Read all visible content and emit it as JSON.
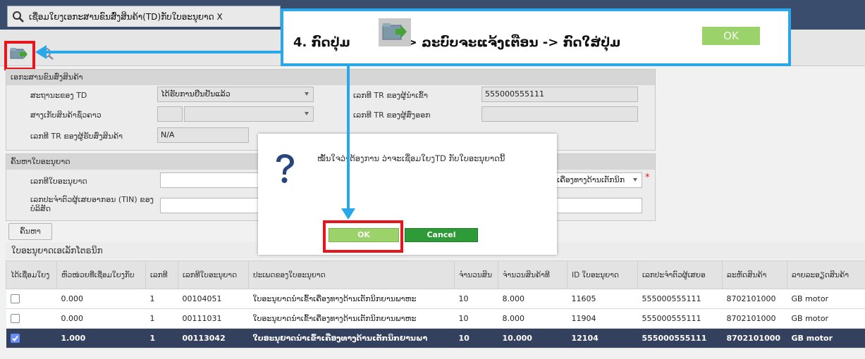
{
  "tab": {
    "title": "ເຊື່ອມໃຍງເອກະສານຂົນສົ່ງສິນຄ້າ(TD)ກັບໃບອະນຸຍາດ X"
  },
  "instruction": {
    "step": "4.",
    "part1": "ກົດປຸ່ມ",
    "part2": "-> ລະບົບຈະແຈ້ງເຕືອນ -> ກົດໃສ່ປຸ່ມ",
    "ok_label": "OK"
  },
  "panel1": {
    "header": "ເອກະສານຂົນສົ່ງສິນຄ້າ",
    "td_status_label": "ສະຖານະຂອງ TD",
    "td_status_value": "ໄດ້ຮັບການຢືນຢັນແລ້ວ",
    "carrier_tr_label": "ເລກທີ TR ຂອງຜູ້ນໍາເຂົ້າ",
    "carrier_tr_value": "555000555111",
    "transit_label": "ສາງເກັບສິນຄ້າຊົ່ວຄາວ",
    "transit_value": "",
    "sender_tr_label": "ເລກທີ TR ຂອງຜູ້ສົ່ງອອກ",
    "sender_tr_value": "",
    "receiver_tr_label": "ເລກທີ TR ຂອງຜູ້ຮັບສົ່ງສິນຄ້າ",
    "receiver_tr_value": "N/A"
  },
  "panel2": {
    "header": "ຄົ້ນຫາໃບອະນຸຍາດ",
    "license_no_label": "ເລກທີໃບອະນຸຍາດ",
    "license_no_value": "",
    "license_type_value": "ເຄື່ອງທາງດ້ານເຕັກນິກ",
    "tin_label": "ເລກປະຈໍາຕົວຜູ້ເສຍອາກອນ (TIN) ຂອງບໍລິສັດ",
    "tin_value": "",
    "search_label": "ຄົ້ນຫາ"
  },
  "table": {
    "title": "ໃບອະນຸຍາດເອເລັກໂຕຣນິກ",
    "headers": [
      "ໄດ້ເຊື່ອມໃຍງ",
      "ຫົວໜ່ວຍທີ່ເຊື່ອມໃຍງກັບ",
      "ເລກທີ",
      "ເລກທີໃບອະນຸຍາດ",
      "ປະເພດຂອງໃບອະນຸຍາດ",
      "ຈໍານວນສິນ",
      "ຈໍານວນສິນຄ້າທີ",
      "ID ໃບອະນຸຍາດ",
      "ເລກປະຈໍາຕົວຜູ້ເສຍອ",
      "ລະຫັດສິນຄ້າ",
      "ລາຍລະອຽດສິນຄ້າ"
    ],
    "rows": [
      {
        "linked": false,
        "unit": "0.000",
        "no": "1",
        "license": "00104051",
        "type": "ໃບອະນຸຍາດນໍາເຂົ້າເຄື່ອງທາງດ້ານເຕັກນິກຍານພາຫະ",
        "qty": "10",
        "qty2": "8.000",
        "id": "11605",
        "tin": "555000555111",
        "hs": "8702101000",
        "desc": "GB motor"
      },
      {
        "linked": false,
        "unit": "0.000",
        "no": "1",
        "license": "00111031",
        "type": "ໃບອະນຸຍາດນໍາເຂົ້າເຄື່ອງທາງດ້ານເຕັກນິກຍານພາຫະ",
        "qty": "10",
        "qty2": "8.000",
        "id": "11904",
        "tin": "555000555111",
        "hs": "8702101000",
        "desc": "GB motor"
      },
      {
        "linked": true,
        "unit": "1.000",
        "no": "1",
        "license": "00113042",
        "type": "ໃບອະນຸຍາດນໍາເຂົ້າເຄື່ອງທາງດ້ານເຕັກນິກຍານພາ",
        "qty": "10",
        "qty2": "10.000",
        "id": "12104",
        "tin": "555000555111",
        "hs": "8702101000",
        "desc": "GB motor"
      }
    ]
  },
  "dialog": {
    "message": "ໝັ້ນໃຈວ່າຕ້ອງການ ວ່າຈະເຊື່ອມໃຍງTD ກັບໃບອະນຸຍາດນີ້",
    "ok_label": "OK",
    "cancel_label": "Cancel"
  },
  "colors": {
    "callout_border": "#28a8e9",
    "highlight": "#e8151a",
    "ok_green": "#9bd36a",
    "cancel_green": "#2e9a38",
    "selected_row": "#33415e"
  }
}
